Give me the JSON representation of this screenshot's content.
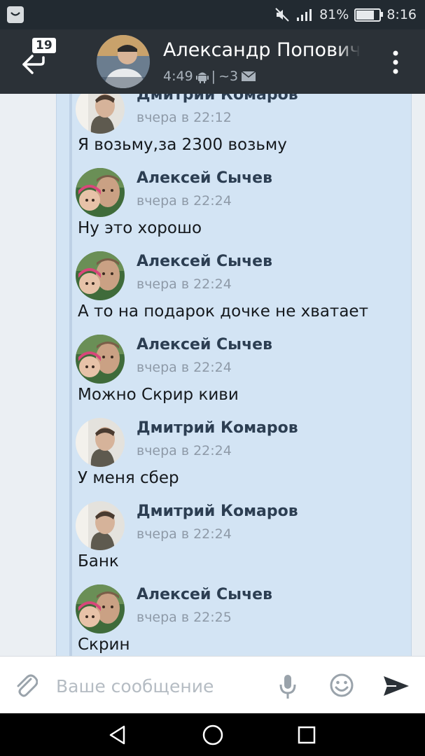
{
  "status_bar": {
    "battery": "81%",
    "battery_level": 0.81,
    "time": "8:16"
  },
  "header": {
    "unread_count": "19",
    "contact_name": "Александр Попович",
    "last_seen": "4:49",
    "separator": "|",
    "message_count": "~3",
    "icons": [
      "back-arrow-icon",
      "android-icon",
      "envelope-icon",
      "more-vert-icon"
    ]
  },
  "messages": [
    {
      "author": "Дмитрий Комаров",
      "time": "вчера в 22:12",
      "text": "Я возьму,за 2300 возьму",
      "avatar": "dmitry"
    },
    {
      "author": "Алексей Сычев",
      "time": "вчера в 22:24",
      "text": "Ну это хорошо",
      "avatar": "alexey"
    },
    {
      "author": "Алексей Сычев",
      "time": "вчера в 22:24",
      "text": "А то на подарок дочке не хватает",
      "avatar": "alexey"
    },
    {
      "author": "Алексей Сычев",
      "time": "вчера в 22:24",
      "text": "Можно Скрир киви",
      "avatar": "alexey"
    },
    {
      "author": "Дмитрий Комаров",
      "time": "вчера в 22:24",
      "text": "У меня сбер",
      "avatar": "dmitry"
    },
    {
      "author": "Дмитрий Комаров",
      "time": "вчера в 22:24",
      "text": "Банк",
      "avatar": "dmitry"
    },
    {
      "author": "Алексей Сычев",
      "time": "вчера в 22:25",
      "text": "Скрин",
      "avatar": "alexey"
    }
  ],
  "composer": {
    "placeholder": "Ваше сообщение",
    "value": "",
    "icons": [
      "attach-icon",
      "mic-icon",
      "emoji-icon",
      "send-icon"
    ]
  },
  "colors": {
    "header_bg": "#2b3137",
    "status_bg": "#222a31",
    "forward_panel": "#d3e4f4",
    "author_name": "#2c3e52",
    "time_gray": "#8e9aa8"
  }
}
